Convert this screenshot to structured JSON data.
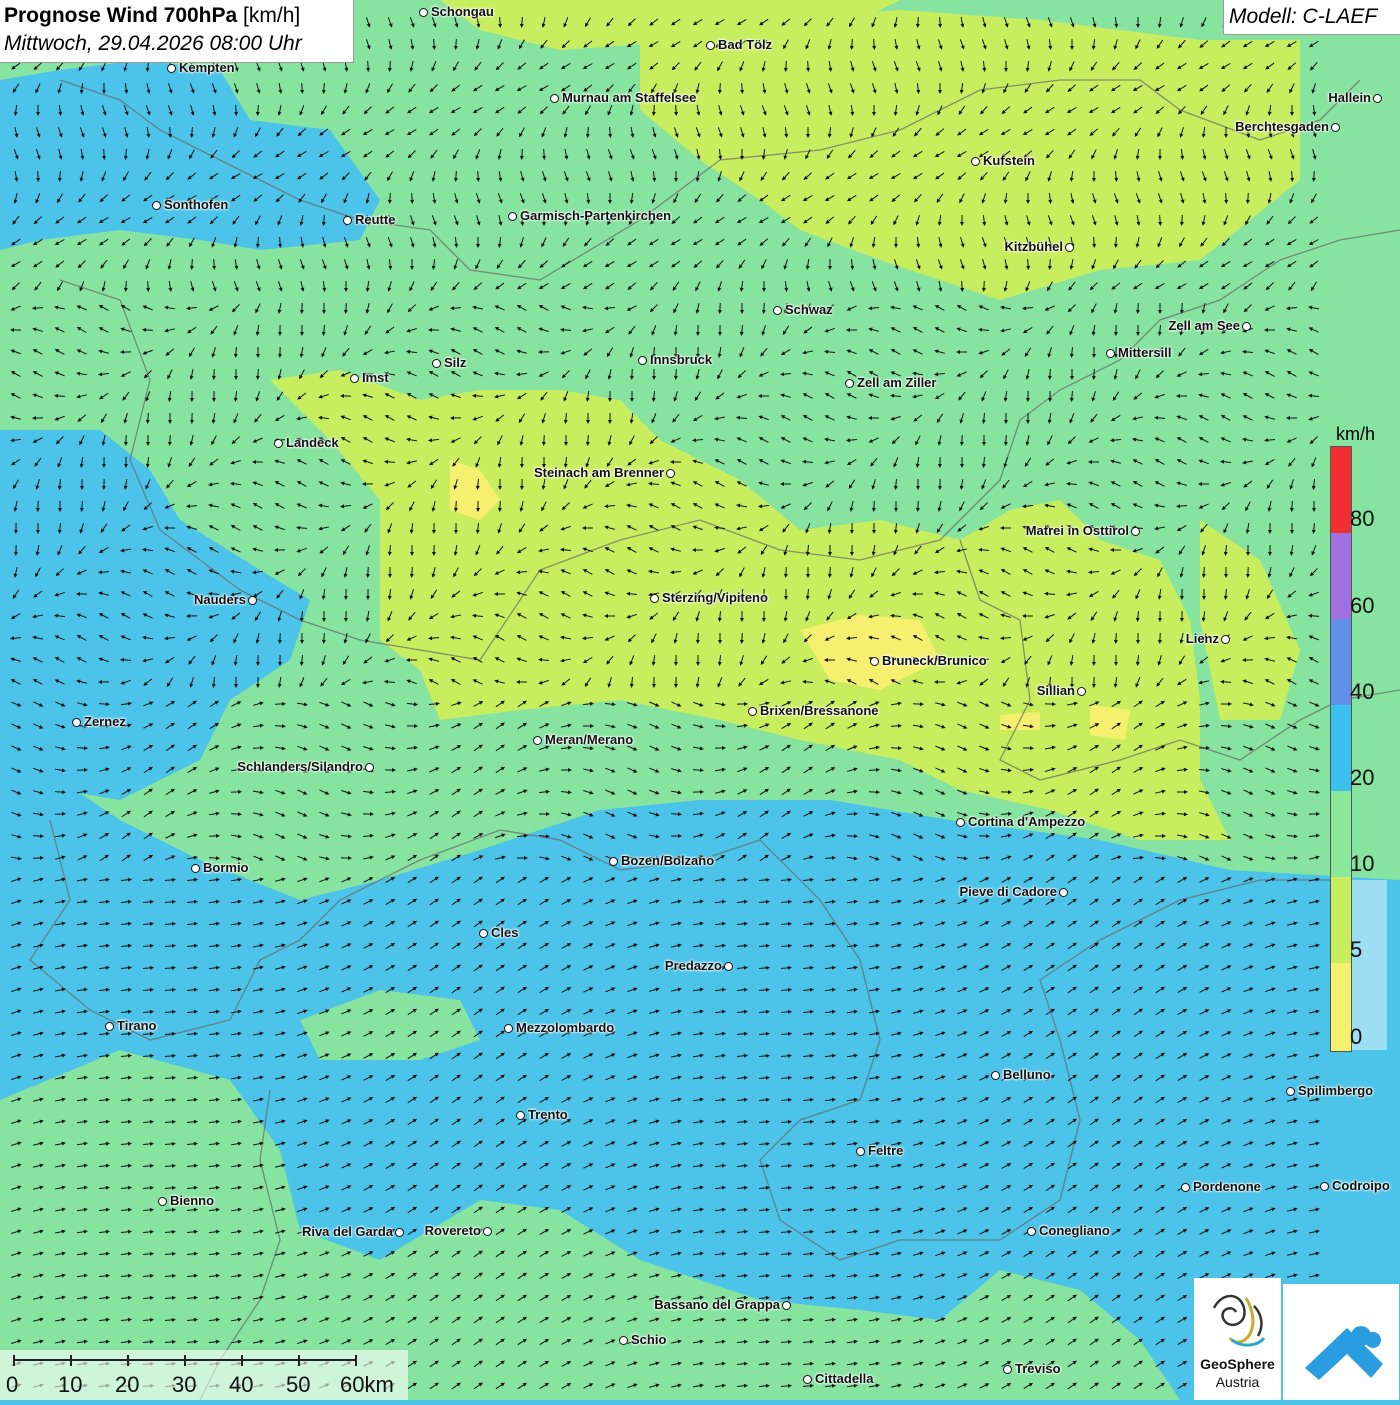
{
  "header": {
    "title_bold": "Prognose Wind 700hPa",
    "title_unit": "[km/h]",
    "datetime": "Mittwoch, 29.04.2026 08:00 Uhr"
  },
  "model": {
    "label": "Modell: C-LAEF"
  },
  "legend": {
    "unit": "km/h",
    "labels": [
      "80",
      "60",
      "40",
      "20",
      "10",
      "5",
      "0"
    ],
    "colors": {
      "80_plus": "#f03030",
      "60_80": "#a070e0",
      "40_60": "#6090e8",
      "20_40": "#3cc0ee",
      "10_20": "#8be89a",
      "5_10": "#c8ee60",
      "0_5": "#f5f070"
    }
  },
  "scale_bar": {
    "labels": [
      "0",
      "10",
      "20",
      "30",
      "40",
      "50",
      "60km"
    ]
  },
  "logos": {
    "geosphere_line1": "GeoSphere",
    "geosphere_line2": "Austria"
  },
  "cities": [
    {
      "name": "Schongau"
    },
    {
      "name": "Bad Tölz"
    },
    {
      "name": "Kempten"
    },
    {
      "name": "Murnau am Staffelsee"
    },
    {
      "name": "Hallein"
    },
    {
      "name": "Berchtesgaden"
    },
    {
      "name": "Kufstein"
    },
    {
      "name": "Sonthofen"
    },
    {
      "name": "Reutte"
    },
    {
      "name": "Garmisch-Partenkirchen"
    },
    {
      "name": "Kitzbühel"
    },
    {
      "name": "Schwaz"
    },
    {
      "name": "Zell am See"
    },
    {
      "name": "Mittersill"
    },
    {
      "name": "Silz"
    },
    {
      "name": "Innsbruck"
    },
    {
      "name": "Imst"
    },
    {
      "name": "Zell am Ziller"
    },
    {
      "name": "Landeck"
    },
    {
      "name": "Steinach am Brenner"
    },
    {
      "name": "Matrei in Osttirol"
    },
    {
      "name": "Nauders"
    },
    {
      "name": "Sterzing/Vipiteno"
    },
    {
      "name": "Lienz"
    },
    {
      "name": "Bruneck/Brunico"
    },
    {
      "name": "Sillian"
    },
    {
      "name": "Zernez"
    },
    {
      "name": "Brixen/Bressanone"
    },
    {
      "name": "Meran/Merano"
    },
    {
      "name": "Schlanders/Silandro"
    },
    {
      "name": "Cortina d'Ampezzo"
    },
    {
      "name": "Bozen/Bolzano"
    },
    {
      "name": "Bormio"
    },
    {
      "name": "Pieve di Cadore"
    },
    {
      "name": "Cles"
    },
    {
      "name": "Predazzo"
    },
    {
      "name": "Tirano"
    },
    {
      "name": "Mezzolombardo"
    },
    {
      "name": "Belluno"
    },
    {
      "name": "Spilimbergo"
    },
    {
      "name": "Trento"
    },
    {
      "name": "Feltre"
    },
    {
      "name": "Bienno"
    },
    {
      "name": "Pordenone"
    },
    {
      "name": "Codroipo"
    },
    {
      "name": "Riva del Garda"
    },
    {
      "name": "Rovereto"
    },
    {
      "name": "Conegliano"
    },
    {
      "name": "Bassano del Grappa"
    },
    {
      "name": "Schio"
    },
    {
      "name": "Treviso"
    },
    {
      "name": "Cittadella"
    }
  ]
}
